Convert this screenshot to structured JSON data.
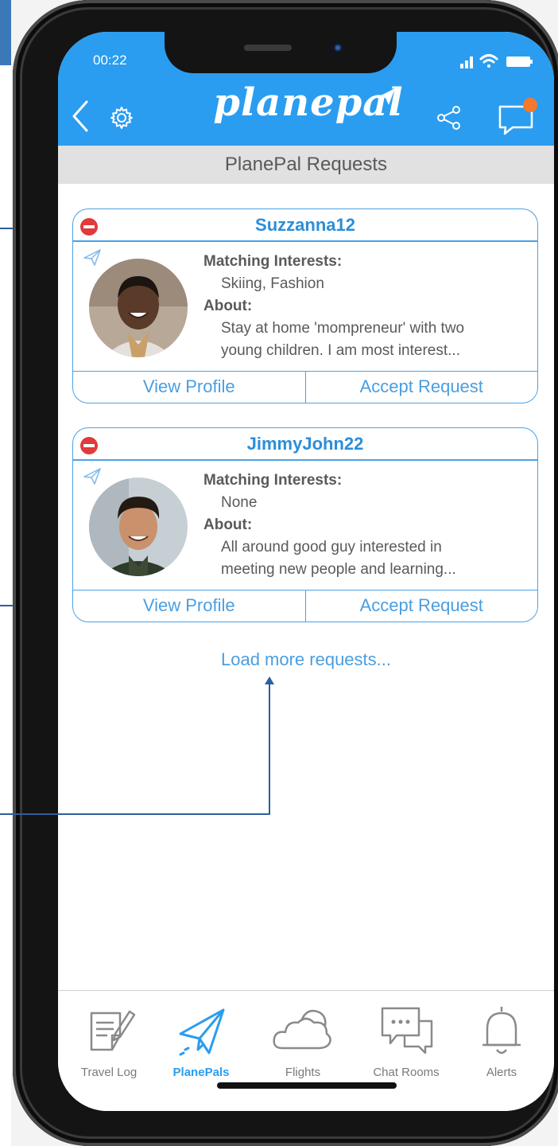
{
  "status": {
    "time": "00:22"
  },
  "header": {
    "brand": "planepal",
    "subtitle": "PlanePal Requests"
  },
  "requests": [
    {
      "username": "Suzzanna12",
      "interests_label": "Matching Interests:",
      "interests": "Skiing, Fashion",
      "about_label": "About:",
      "about_line1": "Stay at home 'mompreneur' with two",
      "about_line2": "young children.  I am most interest...",
      "view_label": "View Profile",
      "accept_label": "Accept Request"
    },
    {
      "username": "JimmyJohn22",
      "interests_label": "Matching Interests:",
      "interests": "None",
      "about_label": "About:",
      "about_line1": "All around good guy interested in",
      "about_line2": "meeting new people and learning...",
      "view_label": "View Profile",
      "accept_label": "Accept Request"
    }
  ],
  "load_more": "Load more requests...",
  "tabs": [
    {
      "label": "Travel Log",
      "icon": "travel-log-icon"
    },
    {
      "label": "PlanePals",
      "icon": "paper-plane-icon",
      "active": true
    },
    {
      "label": "Flights",
      "icon": "cloud-icon"
    },
    {
      "label": "Chat Rooms",
      "icon": "chat-rooms-icon"
    },
    {
      "label": "Alerts",
      "icon": "bell-icon"
    }
  ],
  "colors": {
    "brand_blue": "#2a9df0",
    "link_blue": "#4a9ee0",
    "notification": "#f47a2a",
    "remove_red": "#e03a3a",
    "callout": "#2c5f9e"
  }
}
